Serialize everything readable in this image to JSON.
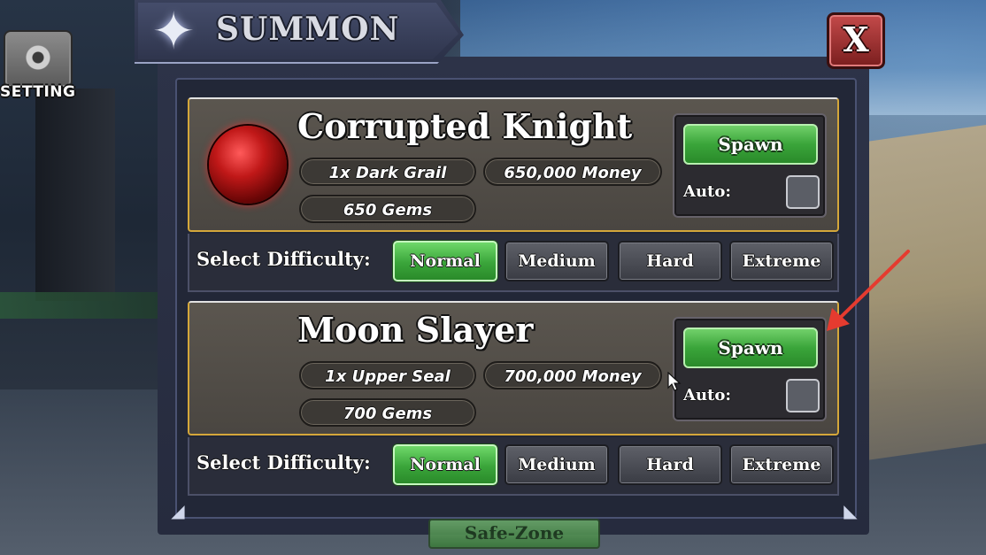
{
  "hud": {
    "setting_label": "SETTING",
    "safe_zone_label": "Safe-Zone"
  },
  "summon": {
    "title": "SUMMON",
    "close_label": "X",
    "bosses": [
      {
        "name": "Corrupted Knight",
        "requirement_item": "1x Dark Grail",
        "requirement_money": "650,000 Money",
        "requirement_gems": "650 Gems",
        "spawn_label": "Spawn",
        "auto_label": "Auto:",
        "difficulty_label": "Select Difficulty:",
        "difficulties": [
          "Normal",
          "Medium",
          "Hard",
          "Extreme"
        ],
        "selected_difficulty": "Normal",
        "icon": "red-orb-icon"
      },
      {
        "name": "Moon Slayer",
        "requirement_item": "1x Upper Seal",
        "requirement_money": "700,000 Money",
        "requirement_gems": "700 Gems",
        "spawn_label": "Spawn",
        "auto_label": "Auto:",
        "difficulty_label": "Select Difficulty:",
        "difficulties": [
          "Normal",
          "Medium",
          "Hard",
          "Extreme"
        ],
        "selected_difficulty": "Normal",
        "icon": ""
      }
    ]
  },
  "colors": {
    "accent_gold": "#d4a73a",
    "spawn_green": "#3aa53a",
    "close_red": "#a52a2a",
    "annotation_arrow": "#e53b2f"
  }
}
